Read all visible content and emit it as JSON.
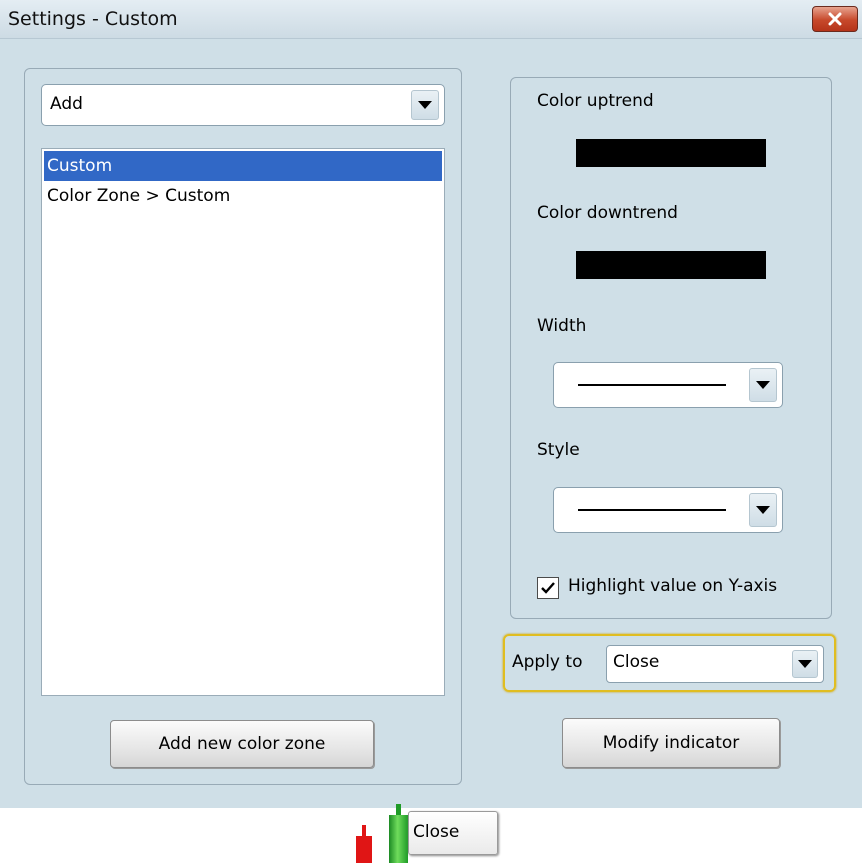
{
  "window": {
    "title": "Settings - Custom"
  },
  "left": {
    "add_combo_value": "Add",
    "list_items": [
      "Custom",
      "Color Zone > Custom"
    ],
    "selected_index": 0,
    "add_zone_button": "Add new color zone"
  },
  "right": {
    "color_uptrend_label": "Color uptrend",
    "color_uptrend": "#000000",
    "color_downtrend_label": "Color downtrend",
    "color_downtrend": "#000000",
    "width_label": "Width",
    "style_label": "Style",
    "highlight_label": "Highlight value on Y-axis",
    "highlight_checked": true
  },
  "apply": {
    "label": "Apply to",
    "value": "Close"
  },
  "modify_button": "Modify indicator",
  "chart_overlay": {
    "close_label": "Close"
  },
  "colors": {
    "dialog_bg": "#cfdfe7",
    "selection": "#3168c6",
    "focus_border": "#e0bd21",
    "close_button": "#c7482b",
    "candle_up": "#1f9b27",
    "candle_down": "#e01515"
  }
}
